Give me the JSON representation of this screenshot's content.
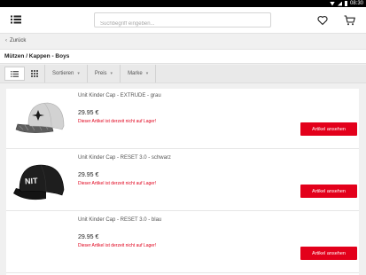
{
  "status_bar": {
    "time": "08:30"
  },
  "header": {
    "search_placeholder": "Suchbegriff eingeben..."
  },
  "nav": {
    "back_label": "Zurück"
  },
  "page": {
    "title": "Mützen / Kappen - Boys"
  },
  "filters": [
    {
      "label": "Sortieren"
    },
    {
      "label": "Preis"
    },
    {
      "label": "Marke"
    }
  ],
  "colors": {
    "accent": "#e3001b",
    "stock_warning": "#e0001b"
  },
  "products": [
    {
      "name": "Unit Kinder Cap - EXTRUDE - grau",
      "price": "29.95 €",
      "stock_note": "Dieser Artikel ist derzeit nicht auf Lager!",
      "button_label": "Artikel ansehen"
    },
    {
      "name": "Unit Kinder Cap - RESET 3.0 - schwarz",
      "price": "29.95 €",
      "stock_note": "Dieser Artikel ist derzeit nicht auf Lager!",
      "button_label": "Artikel ansehen"
    },
    {
      "name": "Unit Kinder Cap - RESET 3.0 - blau",
      "price": "29.95 €",
      "stock_note": "Dieser Artikel ist derzeit nicht auf Lager!",
      "button_label": "Artikel ansehen"
    }
  ]
}
